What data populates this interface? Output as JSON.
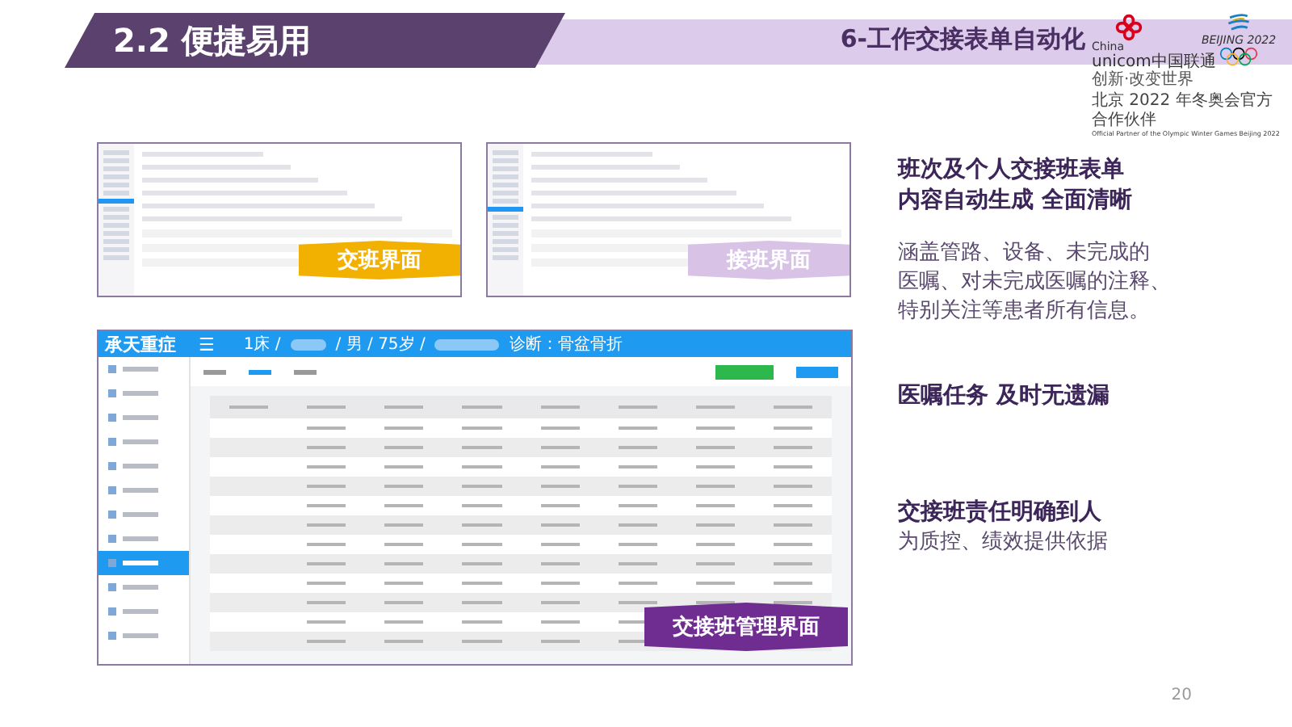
{
  "header": {
    "section_title": "2.2 便捷易用",
    "slide_title": "6-工作交接表单自动化"
  },
  "logos": {
    "unicom_en": "China",
    "unicom_name": "unicom中国联通",
    "unicom_slogan": "创新·改变世界",
    "games": "BEIJING 2022",
    "partner_cn": "北京 2022 年冬奥会官方合作伙伴",
    "partner_en": "Official Partner of the Olympic Winter Games Beijing 2022"
  },
  "screenshots": [
    {
      "kind": "handover",
      "banner": "交班界面"
    },
    {
      "kind": "takeover",
      "banner": "接班界面"
    }
  ],
  "main_screenshot": {
    "logo": "承天重症",
    "menu": "☰",
    "patient": "1床 /",
    "sex_age": "/ 男 / 75岁 /",
    "diagnosis": "诊断：骨盆骨折",
    "banner": "交接班管理界面"
  },
  "points": [
    {
      "heading": [
        "班次及个人交接班表单",
        "内容自动生成 全面清晰"
      ],
      "body": [
        "涵盖管路、设备、未完成的",
        "医嘱、对未完成医嘱的注释、",
        "特别关注等患者所有信息。"
      ]
    },
    {
      "heading": [
        "医嘱任务 及时无遗漏"
      ]
    },
    {
      "heading": [
        "交接班责任明确到人"
      ],
      "body": [
        "为质控、绩效提供依据"
      ]
    }
  ],
  "page_number": "20"
}
